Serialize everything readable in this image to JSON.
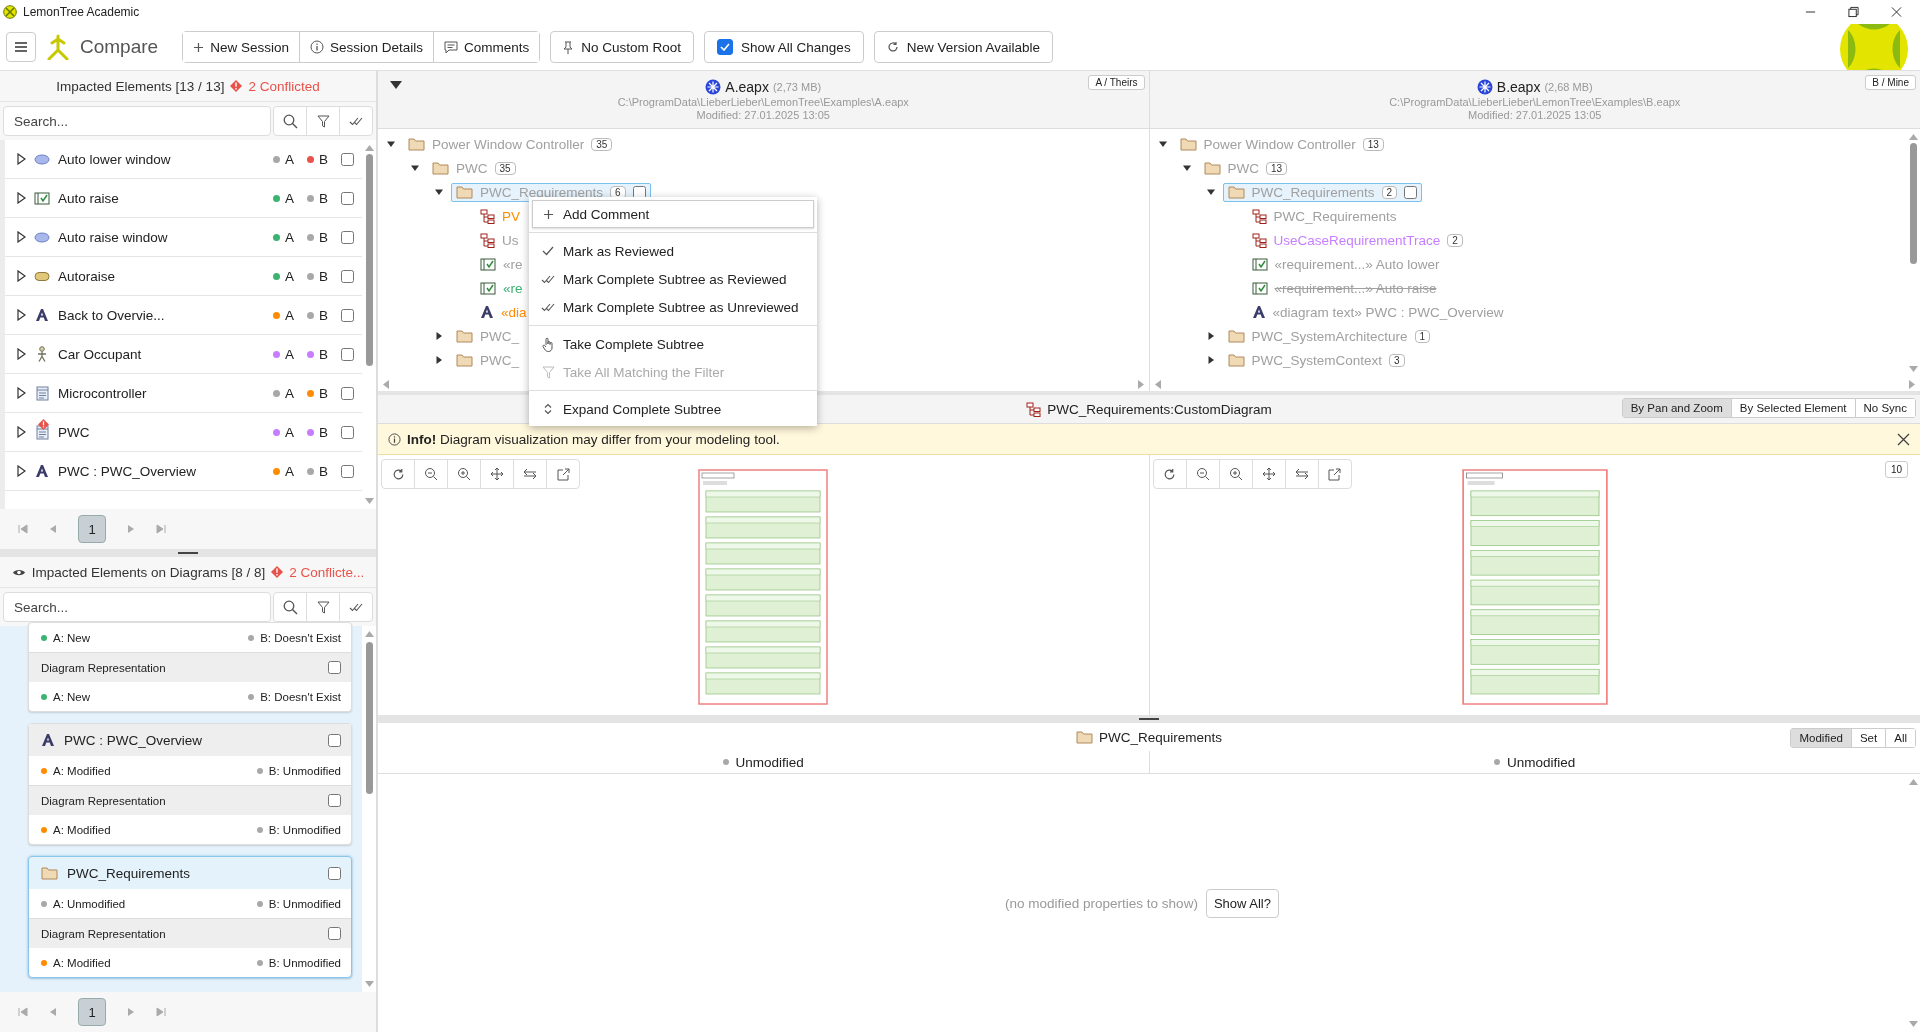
{
  "window": {
    "title": "LemonTree Academic"
  },
  "toolbar": {
    "mode": "Compare",
    "buttons": [
      "New Session",
      "Session Details",
      "Comments"
    ],
    "custom_root": "No Custom Root",
    "show_all_changes": {
      "label": "Show All Changes",
      "checked": true
    },
    "update": "New Version Available"
  },
  "impacted": {
    "title": "Impacted Elements [13 / 13]",
    "conflicts": "2 Conflicted",
    "search": {
      "placeholder": "Search..."
    },
    "page": "1",
    "items": [
      {
        "name": "Auto lower window",
        "kind": "usecase",
        "conflict": false,
        "checked": false,
        "a": {
          "label": "A",
          "color": "#a8a8a8"
        },
        "b": {
          "label": "B",
          "color": "#e8524a"
        }
      },
      {
        "name": "Auto raise",
        "kind": "requirement",
        "conflict": false,
        "checked": false,
        "a": {
          "label": "A",
          "color": "#3cb371"
        },
        "b": {
          "label": "B",
          "color": "#a8a8a8"
        }
      },
      {
        "name": "Auto raise window",
        "kind": "usecase",
        "conflict": false,
        "checked": false,
        "a": {
          "label": "A",
          "color": "#3cb371"
        },
        "b": {
          "label": "B",
          "color": "#a8a8a8"
        }
      },
      {
        "name": "Autoraise",
        "kind": "activity",
        "conflict": false,
        "checked": false,
        "a": {
          "label": "A",
          "color": "#3cb371"
        },
        "b": {
          "label": "B",
          "color": "#a8a8a8"
        }
      },
      {
        "name": "Back to Overvie...",
        "kind": "text",
        "conflict": false,
        "checked": false,
        "a": {
          "label": "A",
          "color": "#ff8c00"
        },
        "b": {
          "label": "B",
          "color": "#a8a8a8"
        }
      },
      {
        "name": "Car Occupant",
        "kind": "actor",
        "conflict": false,
        "checked": false,
        "a": {
          "label": "A",
          "color": "#c77dff"
        },
        "b": {
          "label": "B",
          "color": "#c77dff"
        }
      },
      {
        "name": "Microcontroller",
        "kind": "block",
        "conflict": false,
        "checked": false,
        "a": {
          "label": "A",
          "color": "#a8a8a8"
        },
        "b": {
          "label": "B",
          "color": "#ff8c00"
        }
      },
      {
        "name": "PWC",
        "kind": "block",
        "conflict": true,
        "checked": false,
        "a": {
          "label": "A",
          "color": "#c77dff"
        },
        "b": {
          "label": "B",
          "color": "#c77dff"
        }
      },
      {
        "name": "PWC : PWC_Overview",
        "kind": "text",
        "conflict": false,
        "checked": false,
        "a": {
          "label": "A",
          "color": "#ff8c00"
        },
        "b": {
          "label": "B",
          "color": "#a8a8a8"
        }
      }
    ]
  },
  "diagram_impacts": {
    "title": "Impacted Elements on Diagrams [8 / 8]",
    "conflicts": "2 Conflicte...",
    "search": {
      "placeholder": "Search..."
    },
    "page": "1",
    "cards": [
      {
        "selected": false,
        "rows": [
          {
            "kind": "state",
            "a": {
              "label": "A: New",
              "color": "#3cb371"
            },
            "b": {
              "label": "B: Doesn't Exist",
              "color": "#a8a8a8"
            }
          },
          {
            "kind": "section",
            "label": "Diagram Representation",
            "checked": false
          },
          {
            "kind": "state",
            "a": {
              "label": "A: New",
              "color": "#3cb371"
            },
            "b": {
              "label": "B: Doesn't Exist",
              "color": "#a8a8a8"
            }
          }
        ]
      },
      {
        "selected": false,
        "title": "PWC : PWC_Overview",
        "kind": "text",
        "checked": false,
        "rows": [
          {
            "kind": "state",
            "a": {
              "label": "A: Modified",
              "color": "#ff8c00"
            },
            "b": {
              "label": "B: Unmodified",
              "color": "#a8a8a8"
            }
          },
          {
            "kind": "section",
            "label": "Diagram Representation",
            "checked": false
          },
          {
            "kind": "state",
            "a": {
              "label": "A: Modified",
              "color": "#ff8c00"
            },
            "b": {
              "label": "B: Unmodified",
              "color": "#a8a8a8"
            }
          }
        ]
      },
      {
        "selected": true,
        "title": "PWC_Requirements",
        "kind": "folder",
        "checked": false,
        "rows": [
          {
            "kind": "state",
            "a": {
              "label": "A: Unmodified",
              "color": "#a8a8a8"
            },
            "b": {
              "label": "B: Unmodified",
              "color": "#a8a8a8"
            }
          },
          {
            "kind": "section",
            "label": "Diagram Representation",
            "checked": false
          },
          {
            "kind": "state",
            "a": {
              "label": "A: Modified",
              "color": "#ff8c00"
            },
            "b": {
              "label": "B: Unmodified",
              "color": "#a8a8a8"
            }
          }
        ]
      }
    ]
  },
  "models": [
    {
      "name": "A.eapx",
      "size": "(2,73 MB)",
      "path": "C:\\ProgramData\\LieberLieber\\LemonTree\\Examples\\A.eapx",
      "modified": "Modified: 27.01.2025 13:05",
      "role": "A / Theirs",
      "tree": [
        {
          "label": "Power Window Controller",
          "kind": "folder",
          "color": "#a0a0a0",
          "deleted": false,
          "count": "35",
          "expanded": true,
          "selected": false,
          "children": [
            {
              "label": "PWC",
              "kind": "folder",
              "color": "#a0a0a0",
              "deleted": false,
              "count": "35",
              "expanded": true,
              "selected": false,
              "children": [
                {
                  "label": "PWC_Requirements",
                  "kind": "folder",
                  "color": "#a0a0a0",
                  "deleted": false,
                  "count": "6",
                  "expanded": true,
                  "selected": true,
                  "checked": false,
                  "children": [
                    {
                      "label": "PV",
                      "kind": "diagram",
                      "color": "#ff8c00",
                      "deleted": false,
                      "selected": false
                    },
                    {
                      "label": "Us",
                      "kind": "diagram",
                      "color": "#a0a0a0",
                      "deleted": false,
                      "selected": false
                    },
                    {
                      "label": "«re",
                      "kind": "requirement",
                      "color": "#a0a0a0",
                      "deleted": false,
                      "selected": false
                    },
                    {
                      "label": "«re",
                      "kind": "requirement",
                      "color": "#3cb371",
                      "deleted": false,
                      "selected": false
                    },
                    {
                      "label": "«dia",
                      "kind": "text",
                      "color": "#ff8c00",
                      "deleted": false,
                      "selected": false
                    }
                  ]
                },
                {
                  "label": "PWC_",
                  "kind": "folder",
                  "color": "#a0a0a0",
                  "deleted": false,
                  "expanded": false,
                  "selected": false
                },
                {
                  "label": "PWC_",
                  "kind": "folder",
                  "color": "#a0a0a0",
                  "deleted": false,
                  "expanded": false,
                  "selected": false
                }
              ]
            }
          ]
        }
      ]
    },
    {
      "name": "B.eapx",
      "size": "(2,68 MB)",
      "path": "C:\\ProgramData\\LieberLieber\\LemonTree\\Examples\\B.eapx",
      "modified": "Modified: 27.01.2025 13:05",
      "role": "B / Mine",
      "tree": [
        {
          "label": "Power Window Controller",
          "kind": "folder",
          "color": "#a0a0a0",
          "deleted": false,
          "count": "13",
          "expanded": true,
          "selected": false,
          "children": [
            {
              "label": "PWC",
              "kind": "folder",
              "color": "#a0a0a0",
              "deleted": false,
              "count": "13",
              "expanded": true,
              "selected": false,
              "children": [
                {
                  "label": "PWC_Requirements",
                  "kind": "folder",
                  "color": "#a0a0a0",
                  "deleted": false,
                  "count": "2",
                  "expanded": true,
                  "selected": true,
                  "checked": false,
                  "children": [
                    {
                      "label": "PWC_Requirements",
                      "kind": "diagram",
                      "color": "#a0a0a0",
                      "deleted": false,
                      "selected": false
                    },
                    {
                      "label": "UseCaseRequirementTrace",
                      "kind": "diagram",
                      "color": "#c77dff",
                      "deleted": false,
                      "count": "2",
                      "selected": false
                    },
                    {
                      "label": "«requirement...» Auto lower",
                      "kind": "requirement",
                      "color": "#a0a0a0",
                      "deleted": false,
                      "selected": false
                    },
                    {
                      "label": "«requirement...» Auto raise",
                      "kind": "requirement",
                      "color": "#a0a0a0",
                      "deleted": true,
                      "selected": false
                    },
                    {
                      "label": "«diagram text» PWC : PWC_Overview",
                      "kind": "text",
                      "color": "#a0a0a0",
                      "deleted": false,
                      "selected": false
                    }
                  ]
                },
                {
                  "label": "PWC_SystemArchitecture",
                  "kind": "folder",
                  "color": "#a0a0a0",
                  "deleted": false,
                  "count": "1",
                  "expanded": false,
                  "selected": false
                },
                {
                  "label": "PWC_SystemContext",
                  "kind": "folder",
                  "color": "#a0a0a0",
                  "deleted": false,
                  "count": "3",
                  "expanded": false,
                  "selected": false
                }
              ]
            }
          ]
        }
      ]
    }
  ],
  "context_menu": {
    "items": [
      {
        "kind": "add",
        "label": "Add Comment",
        "selected": true,
        "disabled": false
      },
      {
        "kind": "separator"
      },
      {
        "kind": "mark",
        "label": "Mark as Reviewed",
        "selected": false,
        "disabled": false
      },
      {
        "kind": "mark-subtree",
        "label": "Mark Complete Subtree as Reviewed",
        "selected": false,
        "disabled": false
      },
      {
        "kind": "mark-subtree",
        "label": "Mark Complete Subtree as Unreviewed",
        "selected": false,
        "disabled": false
      },
      {
        "kind": "separator"
      },
      {
        "kind": "take",
        "label": "Take Complete Subtree",
        "selected": false,
        "disabled": false
      },
      {
        "kind": "filter",
        "label": "Take All Matching the Filter",
        "selected": false,
        "disabled": true
      },
      {
        "kind": "separator"
      },
      {
        "kind": "expand",
        "label": "Expand Complete Subtree",
        "selected": false,
        "disabled": false
      }
    ]
  },
  "diagram": {
    "title": "PWC_Requirements:CustomDiagram",
    "sync": [
      {
        "label": "By Pan and Zoom",
        "selected": true
      },
      {
        "label": "By Selected Element",
        "selected": false
      },
      {
        "label": "No Sync",
        "selected": false
      }
    ],
    "info": "**Info!** Diagram visualization may differ from your modeling tool.",
    "zoom_badge": "10"
  },
  "properties": {
    "title": "PWC_Requirements",
    "filters": [
      {
        "label": "Modified",
        "selected": true
      },
      {
        "label": "Set",
        "selected": false
      },
      {
        "label": "All",
        "selected": false
      }
    ],
    "a_status": {
      "label": "Unmodified",
      "color": "#a8a8a8"
    },
    "b_status": {
      "label": "Unmodified",
      "color": "#a8a8a8"
    },
    "empty": "(no modified properties to show)",
    "show_all": "Show All?"
  }
}
